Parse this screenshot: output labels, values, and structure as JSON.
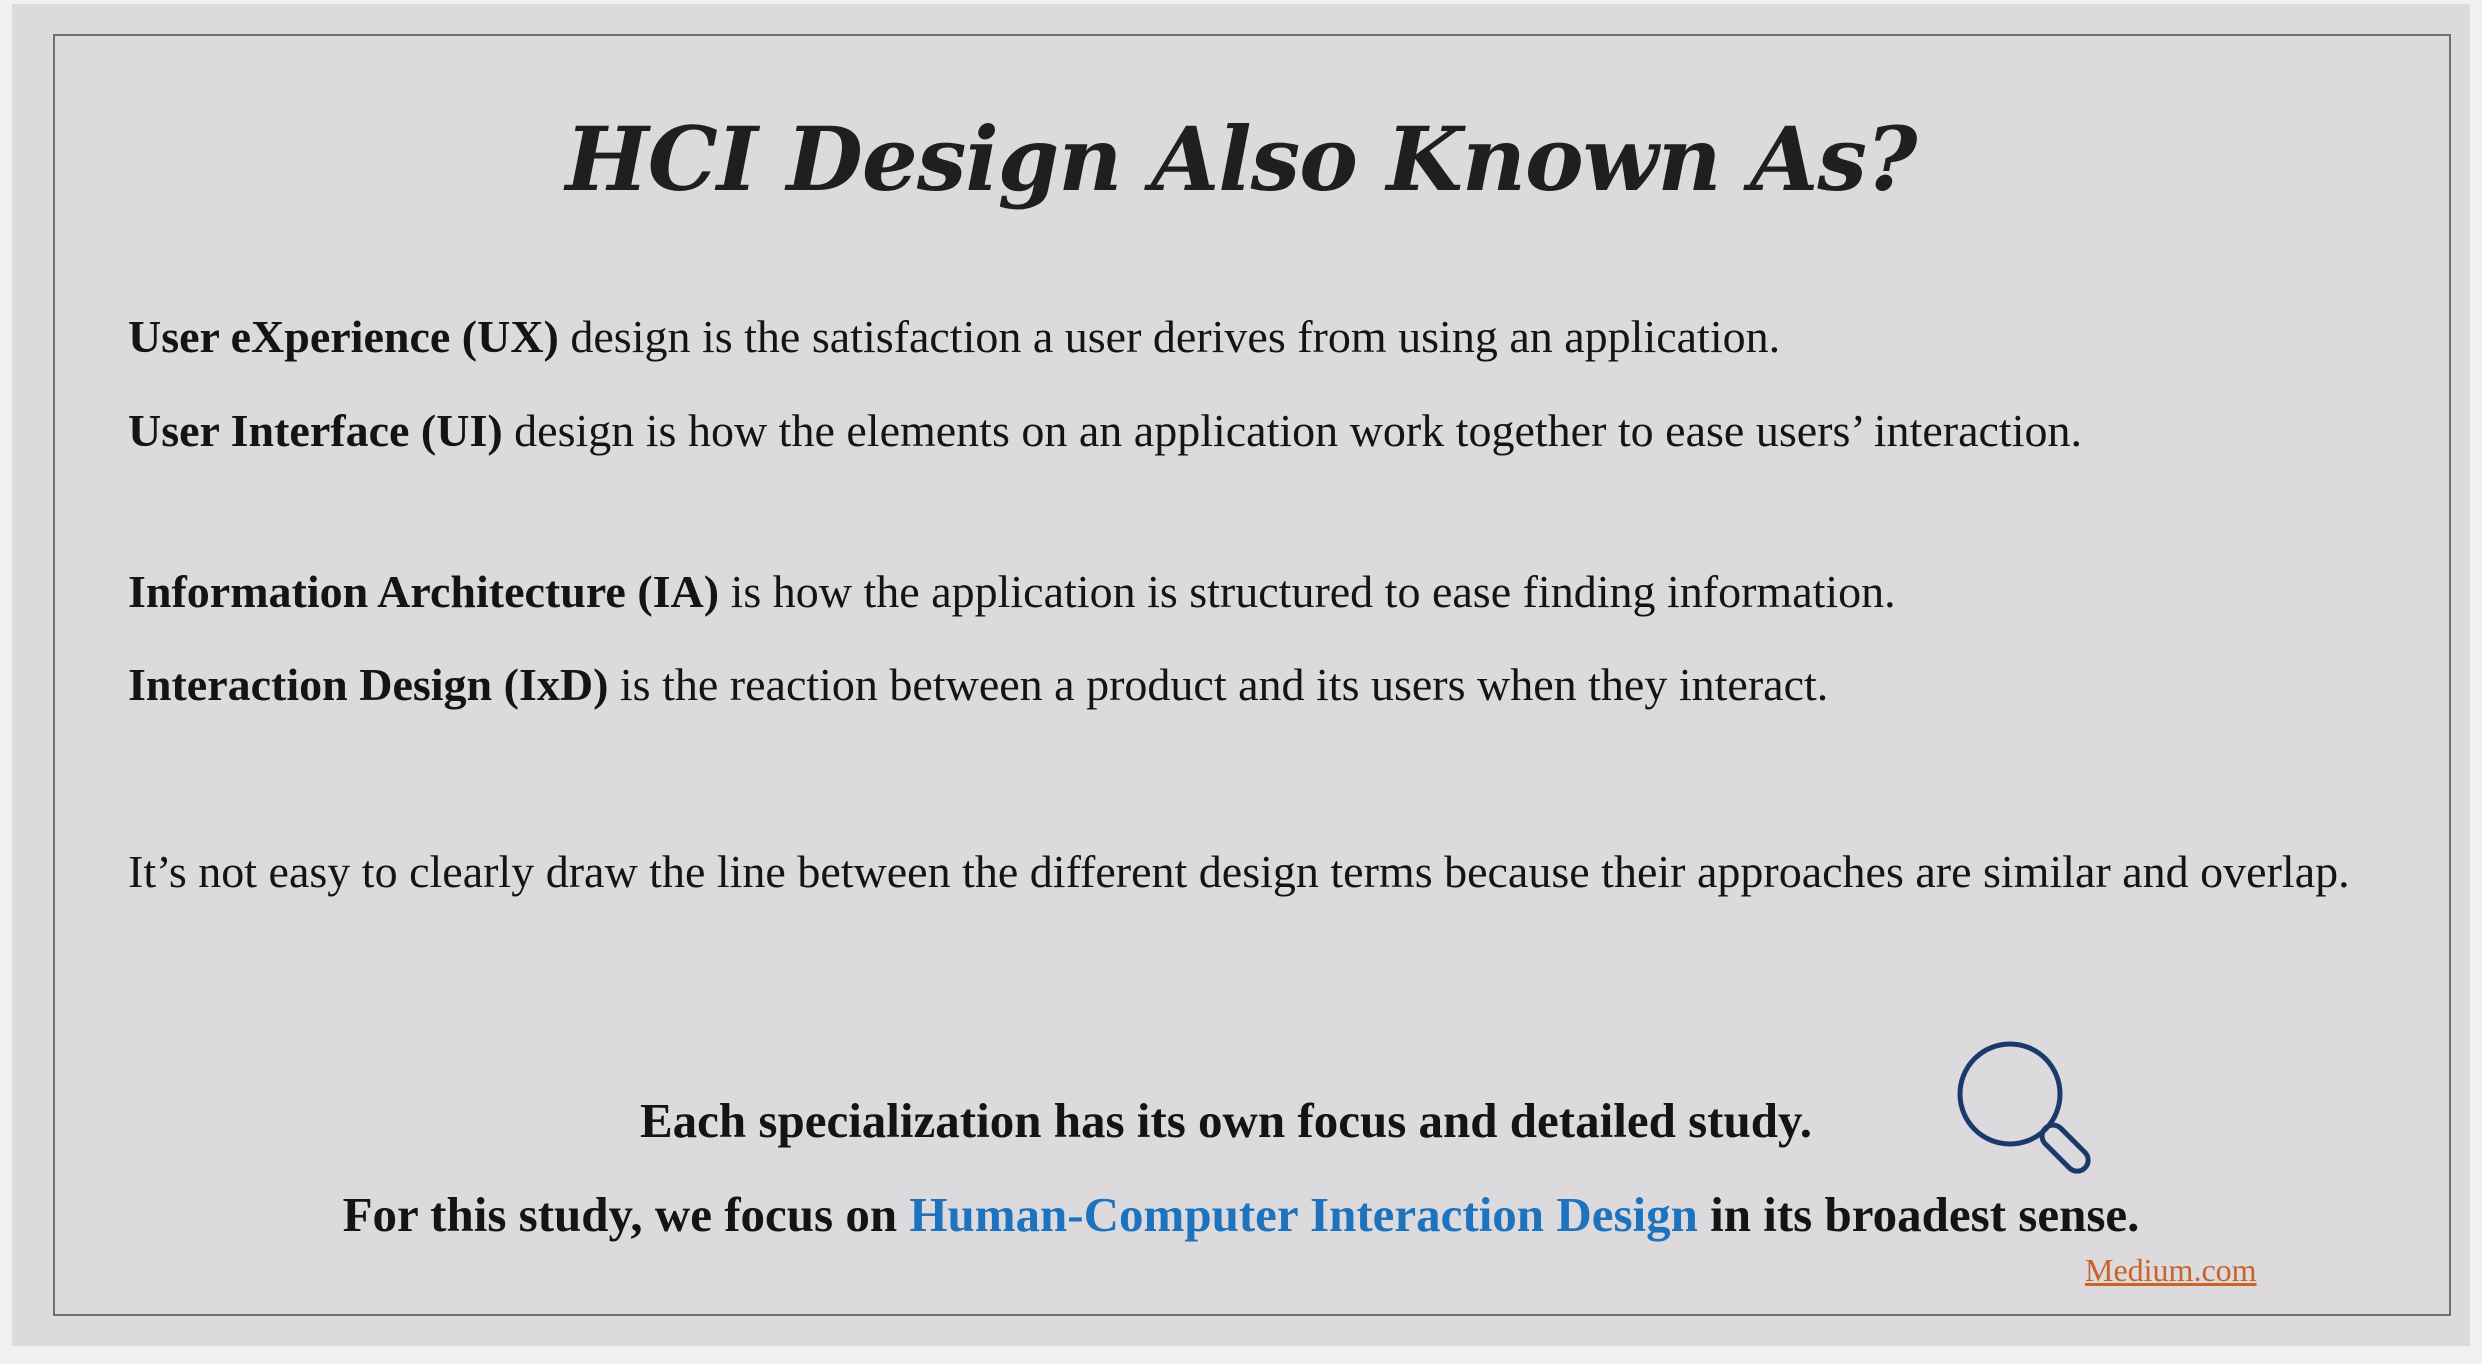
{
  "title": "HCI Design Also Known As?",
  "definitions": [
    {
      "term": "User eXperience (UX)",
      "text": " design is the satisfaction a user derives from using an application."
    },
    {
      "term": "User Interface (UI)",
      "text": " design is how the elements on an application work together to ease users’ interaction."
    },
    {
      "term": "Information Architecture (IA)",
      "text": " is how the application is structured to ease finding information."
    },
    {
      "term": "Interaction Design (IxD)",
      "text": " is the reaction between a product and its users when they interact."
    }
  ],
  "note": "It’s not easy to clearly draw the line between the different design terms because their approaches are similar and overlap.",
  "emphasis_line": "Each specialization has its own focus and detailed study.",
  "focus_line": {
    "before": "For this study, we focus on ",
    "highlight": "Human-Computer Interaction Design",
    "after": " in its broadest sense."
  },
  "source": "Medium.com",
  "colors": {
    "highlight": "#1e73be",
    "source_link": "#c8642a",
    "icon": "#1a3a6b",
    "background": "#dcdadd"
  },
  "icons": {
    "search": "search-icon"
  }
}
